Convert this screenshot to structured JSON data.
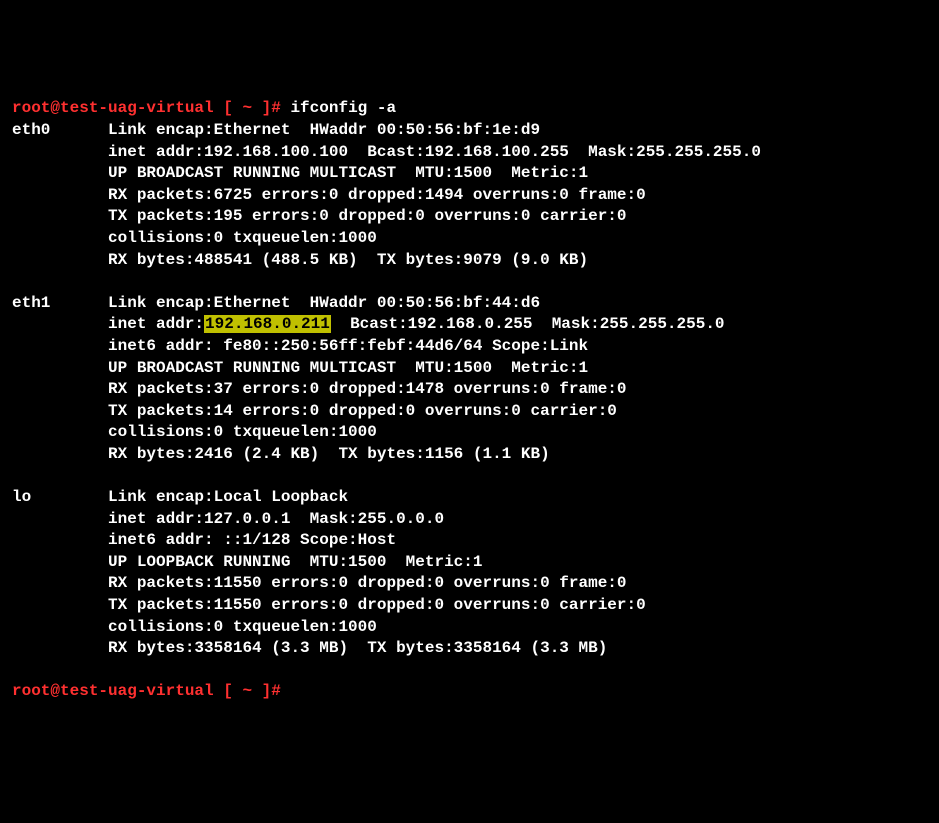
{
  "prompt1": "root@test-uag-virtual [ ~ ]#",
  "prompt2": "root@test-uag-virtual [ ~ ]#",
  "command": "ifconfig -a",
  "eth0": {
    "name": "eth0",
    "encap": "Link encap:Ethernet  HWaddr 00:50:56:bf:1e:d9",
    "inet": "inet addr:192.168.100.100  Bcast:192.168.100.255  Mask:255.255.255.0",
    "flags": "UP BROADCAST RUNNING MULTICAST  MTU:1500  Metric:1",
    "rxp": "RX packets:6725 errors:0 dropped:1494 overruns:0 frame:0",
    "txp": "TX packets:195 errors:0 dropped:0 overruns:0 carrier:0",
    "coll": "collisions:0 txqueuelen:1000",
    "bytes": "RX bytes:488541 (488.5 KB)  TX bytes:9079 (9.0 KB)"
  },
  "eth1": {
    "name": "eth1",
    "encap": "Link encap:Ethernet  HWaddr 00:50:56:bf:44:d6",
    "inet_pre": "inet addr:",
    "inet_ip": "192.168.0.211",
    "inet_post": "  Bcast:192.168.0.255  Mask:255.255.255.0",
    "inet6": "inet6 addr: fe80::250:56ff:febf:44d6/64 Scope:Link",
    "flags": "UP BROADCAST RUNNING MULTICAST  MTU:1500  Metric:1",
    "rxp": "RX packets:37 errors:0 dropped:1478 overruns:0 frame:0",
    "txp": "TX packets:14 errors:0 dropped:0 overruns:0 carrier:0",
    "coll": "collisions:0 txqueuelen:1000",
    "bytes": "RX bytes:2416 (2.4 KB)  TX bytes:1156 (1.1 KB)"
  },
  "lo": {
    "name": "lo",
    "encap": "Link encap:Local Loopback",
    "inet": "inet addr:127.0.0.1  Mask:255.0.0.0",
    "inet6": "inet6 addr: ::1/128 Scope:Host",
    "flags": "UP LOOPBACK RUNNING  MTU:1500  Metric:1",
    "rxp": "RX packets:11550 errors:0 dropped:0 overruns:0 frame:0",
    "txp": "TX packets:11550 errors:0 dropped:0 overruns:0 carrier:0",
    "coll": "collisions:0 txqueuelen:1000",
    "bytes": "RX bytes:3358164 (3.3 MB)  TX bytes:3358164 (3.3 MB)"
  }
}
